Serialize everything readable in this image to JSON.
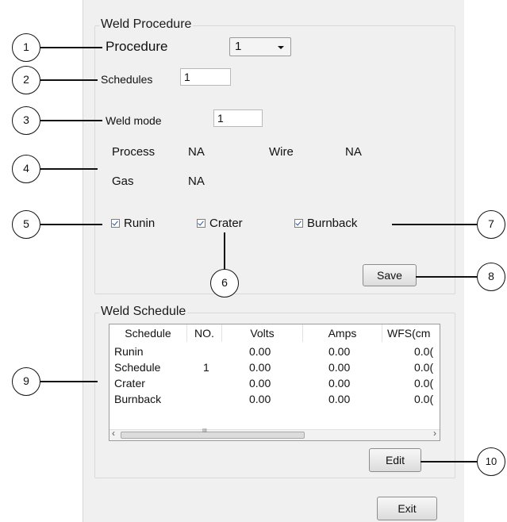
{
  "weld_procedure": {
    "title": "Weld Procedure",
    "procedure_label": "Procedure",
    "procedure_value": "1",
    "schedules_label": "Schedules",
    "schedules_value": "1",
    "weld_mode_label": "Weld mode",
    "weld_mode_value": "1",
    "process_label": "Process",
    "process_value": "NA",
    "wire_label": "Wire",
    "wire_value": "NA",
    "gas_label": "Gas",
    "gas_value": "NA",
    "runin_label": "Runin",
    "crater_label": "Crater",
    "burnback_label": "Burnback",
    "runin_checked": true,
    "crater_checked": true,
    "burnback_checked": true,
    "save_label": "Save"
  },
  "weld_schedule": {
    "title": "Weld Schedule",
    "columns": [
      "Schedule",
      "NO.",
      "Volts",
      "Amps",
      "WFS(cm"
    ],
    "rows": [
      [
        "Runin",
        "",
        "0.00",
        "0.00",
        "0.0("
      ],
      [
        "Schedule",
        "1",
        "0.00",
        "0.00",
        "0.0("
      ],
      [
        "Crater",
        "",
        "0.00",
        "0.00",
        "0.0("
      ],
      [
        "Burnback",
        "",
        "0.00",
        "0.00",
        "0.0("
      ]
    ],
    "scroll_left": "‹",
    "scroll_right": "›",
    "scroll_grip": "III",
    "edit_label": "Edit"
  },
  "exit_label": "Exit",
  "callouts": [
    "1",
    "2",
    "3",
    "4",
    "5",
    "6",
    "7",
    "8",
    "9",
    "10"
  ]
}
